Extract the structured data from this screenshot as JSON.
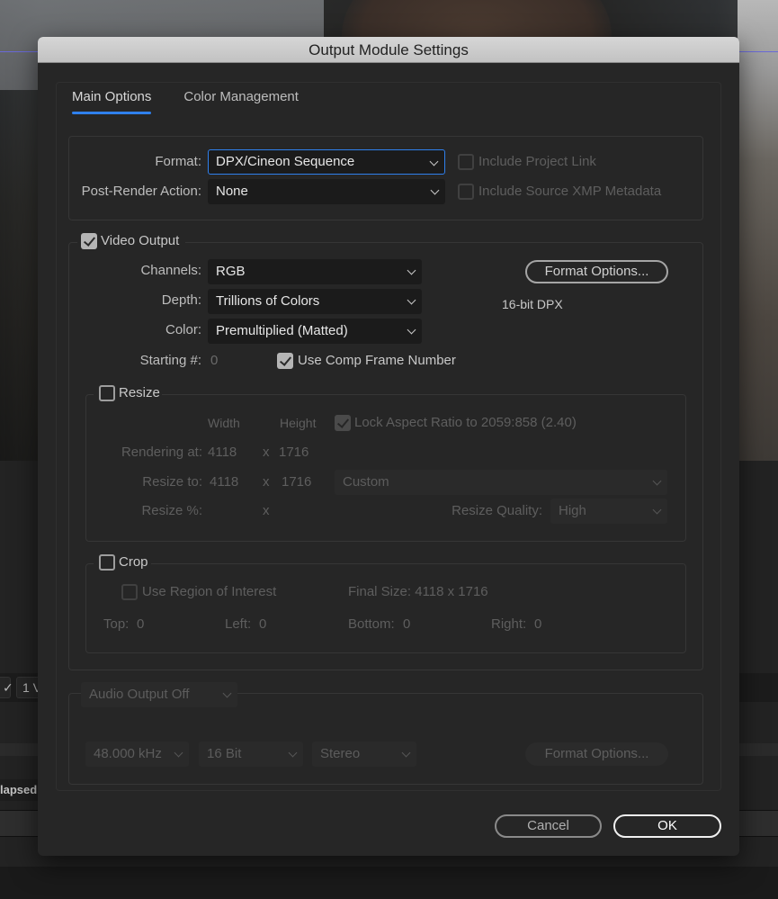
{
  "background": {
    "toolbar_chip_1": "✓",
    "toolbar_chip_2": "1 V",
    "elapsed_label": "lapsed:"
  },
  "dialog": {
    "title": "Output Module Settings",
    "tabs": [
      {
        "label": "Main Options",
        "active": true
      },
      {
        "label": "Color Management",
        "active": false
      }
    ],
    "format": {
      "label": "Format:",
      "value": "DPX/Cineon Sequence"
    },
    "post_render_action": {
      "label": "Post-Render Action:",
      "value": "None"
    },
    "include_project_link": {
      "label": "Include Project Link",
      "checked": false,
      "enabled": false
    },
    "include_xmp": {
      "label": "Include Source XMP Metadata",
      "checked": false,
      "enabled": false
    },
    "video_output": {
      "label": "Video Output",
      "checked": true,
      "channels": {
        "label": "Channels:",
        "value": "RGB"
      },
      "depth": {
        "label": "Depth:",
        "value": "Trillions of Colors"
      },
      "color": {
        "label": "Color:",
        "value": "Premultiplied (Matted)"
      },
      "starting_number": {
        "label": "Starting #:",
        "value": "0"
      },
      "use_comp_frame_number": {
        "label": "Use Comp Frame Number",
        "checked": true
      },
      "format_options_button": "Format Options...",
      "format_info": "16-bit DPX"
    },
    "resize": {
      "label": "Resize",
      "checked": false,
      "width_header": "Width",
      "height_header": "Height",
      "lock_aspect": {
        "label": "Lock Aspect Ratio to 2059:858 (2.40)",
        "checked": true
      },
      "rendering_at": {
        "label": "Rendering at:",
        "width": "4118",
        "x": "x",
        "height": "1716"
      },
      "resize_to": {
        "label": "Resize to:",
        "width": "4118",
        "x": "x",
        "height": "1716",
        "preset": "Custom"
      },
      "resize_percent": {
        "label": "Resize %:",
        "x": "x"
      },
      "resize_quality": {
        "label": "Resize Quality:",
        "value": "High"
      }
    },
    "crop": {
      "label": "Crop",
      "checked": false,
      "use_roi": {
        "label": "Use Region of Interest",
        "checked": false
      },
      "final_size": "Final Size: 4118 x 1716",
      "top": {
        "label": "Top:",
        "value": "0"
      },
      "left": {
        "label": "Left:",
        "value": "0"
      },
      "bottom": {
        "label": "Bottom:",
        "value": "0"
      },
      "right": {
        "label": "Right:",
        "value": "0"
      }
    },
    "audio": {
      "output": "Audio Output Off",
      "sample_rate": "48.000 kHz",
      "bit_depth": "16 Bit",
      "channels": "Stereo",
      "format_options_button": "Format Options..."
    },
    "buttons": {
      "cancel": "Cancel",
      "ok": "OK"
    }
  },
  "colors": {
    "accent": "#2f80ed",
    "dialog_bg": "#262626",
    "titlebar_bg": "#c8c8c8"
  }
}
